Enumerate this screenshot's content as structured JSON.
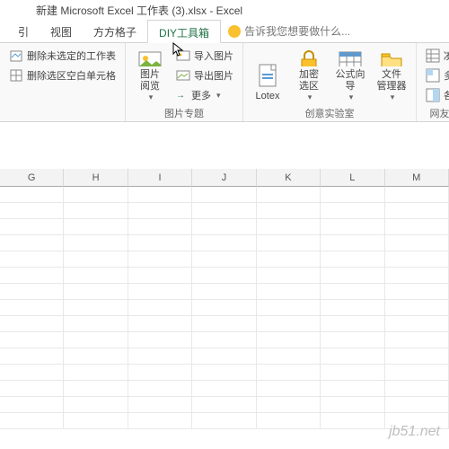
{
  "title": "新建 Microsoft Excel 工作表 (3).xlsx - Excel",
  "tabs": {
    "t0": "引",
    "t1": "视图",
    "t2": "方方格子",
    "t3": "DIY工具箱",
    "tell": "告诉我您想要做什么..."
  },
  "g1": {
    "btn1": "删除未选定的工作表",
    "btn2": "删除选区空白单元格"
  },
  "g2": {
    "big": "图片\n阅览",
    "s1": "导入图片",
    "s2": "导出图片",
    "s3": "更多",
    "label": "图片专题"
  },
  "g3": {
    "b1": "Lotex",
    "b2": "加密\n选区",
    "b3": "公式向\n导",
    "b4": "文件\n管理器",
    "label": "创意实验室"
  },
  "g4": {
    "s1": "凑数",
    "s2": "多区域汇总",
    "s3": "各列累计汇",
    "label": "网友建议直达"
  },
  "cols": [
    "G",
    "H",
    "I",
    "J",
    "K",
    "L",
    "M"
  ],
  "watermark": "jb51.net"
}
